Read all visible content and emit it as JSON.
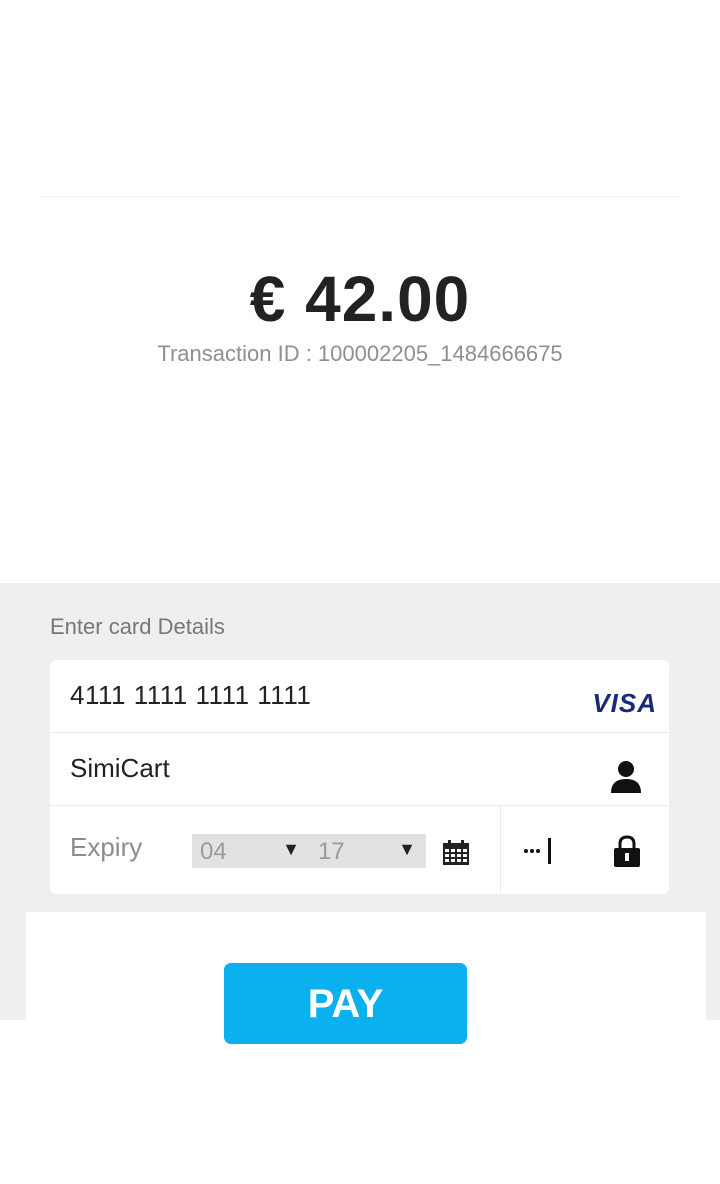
{
  "payment": {
    "amount": "€ 42.00",
    "transaction_id": "Transaction ID : 100002205_1484666675"
  },
  "card_form": {
    "title": "Enter card Details",
    "card_number": "4111 1111 1111 1111",
    "card_brand": "VISA",
    "holder_name": "SimiCart",
    "expiry_label": "Expiry",
    "expiry_month": "04",
    "expiry_year": "17",
    "dropdown_arrow": "▼"
  },
  "actions": {
    "pay_label": "PAY"
  },
  "colors": {
    "accent": "#0bb1ee",
    "panel_bg": "#efefef",
    "visa_blue": "#1a2a7a"
  },
  "icons": [
    "person-icon",
    "calendar-icon",
    "cvv-icon",
    "lock-icon"
  ]
}
